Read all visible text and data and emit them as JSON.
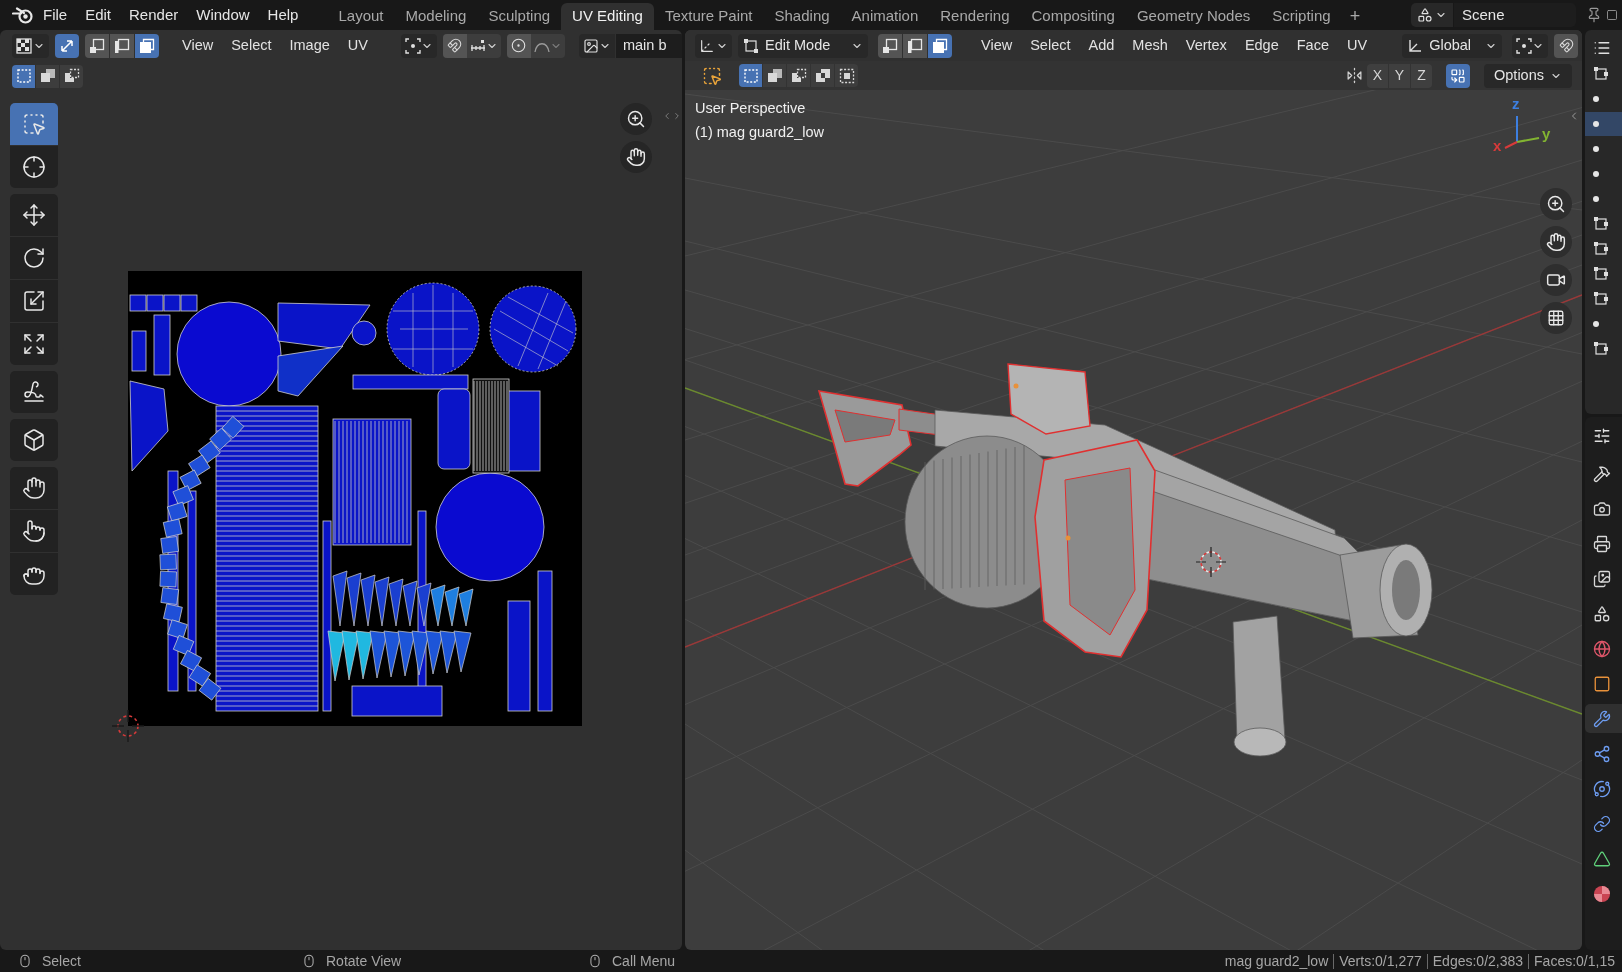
{
  "top_bar": {
    "menus": [
      "File",
      "Edit",
      "Render",
      "Window",
      "Help"
    ],
    "workspaces": [
      {
        "label": "Layout",
        "selected": false
      },
      {
        "label": "Modeling",
        "selected": false
      },
      {
        "label": "Sculpting",
        "selected": false
      },
      {
        "label": "UV Editing",
        "selected": true
      },
      {
        "label": "Texture Paint",
        "selected": false
      },
      {
        "label": "Shading",
        "selected": false
      },
      {
        "label": "Animation",
        "selected": false
      },
      {
        "label": "Rendering",
        "selected": false
      },
      {
        "label": "Compositing",
        "selected": false
      },
      {
        "label": "Geometry Nodes",
        "selected": false
      },
      {
        "label": "Scripting",
        "selected": false
      }
    ],
    "add_tab": "+",
    "scene": "Scene"
  },
  "uv_editor": {
    "header": {
      "sync_selection": true,
      "select_modes": [
        {
          "kind": "vertex",
          "selected": false
        },
        {
          "kind": "edge",
          "selected": false
        },
        {
          "kind": "face",
          "selected": true
        }
      ],
      "menus": [
        "View",
        "Select",
        "Image",
        "UV"
      ],
      "image_name": "main b"
    },
    "box_modes": [
      {
        "kind": "set",
        "selected": true
      },
      {
        "kind": "extend",
        "selected": false
      },
      {
        "kind": "subtract",
        "selected": false
      }
    ],
    "tool_groups": [
      {
        "tools": [
          {
            "kind": "select_box",
            "selected": true
          },
          {
            "kind": "cursor",
            "selected": false
          }
        ]
      },
      {
        "tools": [
          {
            "kind": "move",
            "selected": false
          },
          {
            "kind": "rotate",
            "selected": false
          },
          {
            "kind": "scale",
            "selected": false
          },
          {
            "kind": "transform",
            "selected": false
          }
        ]
      },
      {
        "tools": [
          {
            "kind": "annotate",
            "selected": false
          }
        ]
      },
      {
        "tools": [
          {
            "kind": "rip",
            "selected": false
          }
        ]
      },
      {
        "tools": [
          {
            "kind": "grab",
            "selected": false
          },
          {
            "kind": "relax",
            "selected": false
          },
          {
            "kind": "pinch",
            "selected": false
          }
        ]
      }
    ]
  },
  "viewport": {
    "header": {
      "mode": "Edit Mode",
      "select_modes": [
        {
          "kind": "vertex",
          "selected": false
        },
        {
          "kind": "edge",
          "selected": false
        },
        {
          "kind": "face",
          "selected": true
        }
      ],
      "menus": [
        "View",
        "Select",
        "Add",
        "Mesh",
        "Vertex",
        "Edge",
        "Face",
        "UV"
      ],
      "orientation": "Global"
    },
    "box_modes": [
      {
        "kind": "set",
        "selected": true
      },
      {
        "kind": "extend",
        "selected": false
      },
      {
        "kind": "subtract",
        "selected": false
      },
      {
        "kind": "difference",
        "selected": false
      },
      {
        "kind": "intersect",
        "selected": false
      }
    ],
    "mirror_axes": [
      {
        "label": "X",
        "selected": false
      },
      {
        "label": "Y",
        "selected": false
      },
      {
        "label": "Z",
        "selected": false
      }
    ],
    "auto_merge": true,
    "options": "Options",
    "overlay_text": [
      "User Perspective",
      "(1) mag guard2_low"
    ],
    "gizmo_axes": [
      {
        "label": "z",
        "color": "#3d7fe0"
      },
      {
        "label": "y",
        "color": "#82b431"
      },
      {
        "label": "x",
        "color": "#d83a3a"
      }
    ]
  },
  "side_panel": {
    "outliner_rows": [
      {
        "kind": "group",
        "selected": false
      },
      {
        "kind": "dot",
        "selected": false
      },
      {
        "kind": "dot",
        "selected": true
      },
      {
        "kind": "dot",
        "selected": false
      },
      {
        "kind": "dot",
        "selected": false
      },
      {
        "kind": "dot",
        "selected": false
      },
      {
        "kind": "group",
        "selected": false
      },
      {
        "kind": "group",
        "selected": false
      },
      {
        "kind": "group",
        "selected": false
      },
      {
        "kind": "group",
        "selected": false
      },
      {
        "kind": "dot",
        "selected": false
      },
      {
        "kind": "group",
        "selected": false
      }
    ],
    "property_tabs": [
      {
        "kind": "tool",
        "selected": false
      },
      {
        "kind": "render",
        "selected": false
      },
      {
        "kind": "output",
        "selected": false
      },
      {
        "kind": "view_layer",
        "selected": false
      },
      {
        "kind": "scene",
        "selected": false
      },
      {
        "kind": "world",
        "selected": false
      },
      {
        "kind": "object",
        "selected": false
      },
      {
        "kind": "modifiers",
        "selected": true
      },
      {
        "kind": "particles",
        "selected": false
      },
      {
        "kind": "physics",
        "selected": false
      },
      {
        "kind": "constraints",
        "selected": false
      },
      {
        "kind": "data",
        "selected": false
      },
      {
        "kind": "material",
        "selected": false
      }
    ]
  },
  "status_bar": {
    "hints": [
      "Select",
      "Rotate View",
      "Call Menu"
    ],
    "stats": [
      "mag guard2_low",
      "Verts:0/1,277",
      "Edges:0/2,383",
      "Faces:0/1,15"
    ]
  }
}
